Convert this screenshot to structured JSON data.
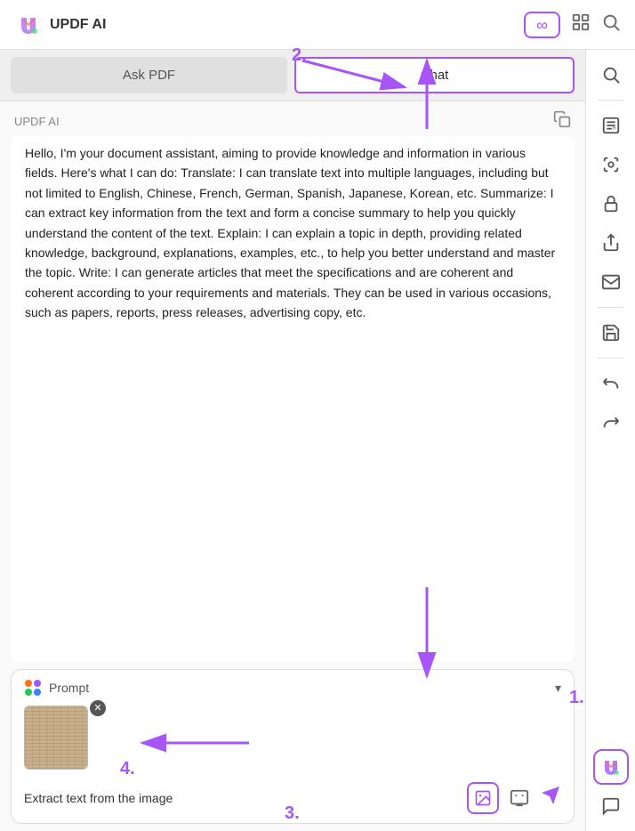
{
  "app": {
    "title": "UPDF AI",
    "tabs": {
      "ask_pdf": "Ask PDF",
      "chat": "Chat",
      "active": "chat"
    },
    "header": {
      "infinity_label": "∞",
      "copy_icon": "⧉",
      "chat_label": "UPDF AI"
    },
    "message": {
      "text": "Hello, I'm your document assistant, aiming to provide knowledge and information in various fields. Here's what I can do:\nTranslate: I can translate text into multiple languages, including but not limited to English, Chinese, French, German, Spanish, Japanese, Korean, etc.\nSummarize: I can extract key information from the text and form a concise summary to help you quickly understand the content of the text.\nExplain: I can explain a topic in depth, providing related knowledge, background, explanations, examples, etc., to help you better understand and master the topic.\nWrite: I can generate articles that meet the specifications and are coherent and coherent according to your requirements and materials. They can be used in various occasions, such as papers, reports, press releases, advertising copy, etc."
    },
    "prompt": {
      "label": "Prompt",
      "placeholder": "Extract text from the image",
      "chevron": "▾"
    },
    "annotations": {
      "label1": "1.",
      "label2": "2.",
      "label3": "3.",
      "label4": "4."
    }
  }
}
